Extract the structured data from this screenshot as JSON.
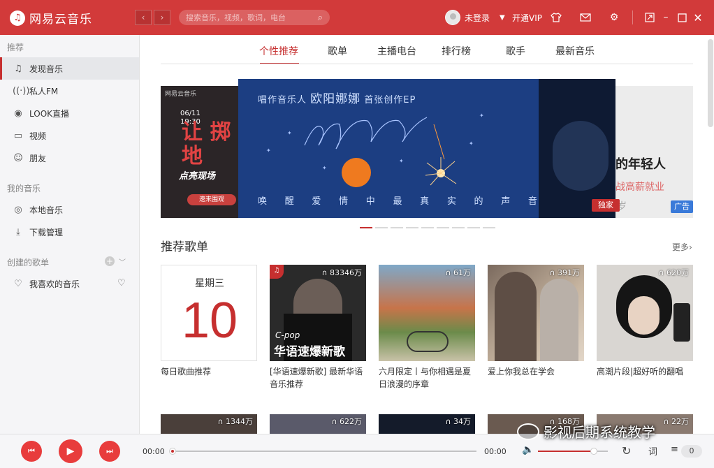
{
  "app": {
    "logo_text": "网易云音乐"
  },
  "titlebar": {
    "back_label": "‹",
    "forward_label": "›",
    "search_placeholder": "搜索音乐，视频，歌词，电台",
    "user_name": "未登录",
    "vip_label": "开通VIP"
  },
  "sidebar": {
    "section_recommend": "推荐",
    "items": [
      {
        "label": "发现音乐",
        "icon": "music-note-icon"
      },
      {
        "label": "私人FM",
        "icon": "radio-icon"
      },
      {
        "label": "LOOK直播",
        "icon": "live-icon"
      },
      {
        "label": "视频",
        "icon": "video-icon"
      },
      {
        "label": "朋友",
        "icon": "friends-icon"
      }
    ],
    "section_my_music": "我的音乐",
    "my_items": [
      {
        "label": "本地音乐",
        "icon": "local-music-icon"
      },
      {
        "label": "下载管理",
        "icon": "download-icon"
      }
    ],
    "section_created": "创建的歌单",
    "created_items": [
      {
        "label": "我喜欢的音乐",
        "icon": "heart-icon"
      }
    ]
  },
  "tabs": [
    "个性推荐",
    "歌单",
    "主播电台",
    "排行榜",
    "歌手",
    "最新音乐"
  ],
  "banner": {
    "left": {
      "mini": "网易云音乐",
      "date": "06/11 19:30",
      "big": "让 掷地",
      "sub": "点亮现场",
      "button": "速来围观"
    },
    "main": {
      "title_prefix": "唱作音乐人",
      "artist": "欧阳娜娜",
      "title_suffix": "首张创作EP",
      "subtitle": [
        "唤",
        "醒",
        "爱",
        "情",
        "中",
        "最",
        "真",
        "实",
        "的",
        "声",
        "音"
      ],
      "exclusive_tag": "独家"
    },
    "right": {
      "text1": "的年轻人",
      "text2": "战高薪就业",
      "text3": "岁",
      "ad_tag": "广告"
    }
  },
  "section": {
    "title": "推荐歌单",
    "more": "更多"
  },
  "daily": {
    "weekday": "星期三",
    "day": "10",
    "caption": "每日歌曲推荐"
  },
  "playlists": [
    {
      "count": "83346万",
      "caption": "[华语速爆新歌] 最新华语音乐推荐",
      "cover_genre": "C-pop",
      "cover_title": "华语速爆新歌"
    },
    {
      "count": "61万",
      "caption": "六月限定丨与你相遇是夏日浪漫的序章"
    },
    {
      "count": "391万",
      "caption": "爱上你我总在学会"
    },
    {
      "count": "620万",
      "caption": "高潮片段|超好听的翻唱"
    }
  ],
  "row2_counts": [
    "1344万",
    "622万",
    "34万",
    "168万",
    "22万"
  ],
  "player": {
    "time_current": "00:00",
    "time_total": "00:00",
    "lyric_label": "词",
    "playlist_count": "0",
    "volume": 0.8
  },
  "watermark": {
    "text": "影视后期系统教学"
  },
  "colors": {
    "brand": "#d23a3a",
    "accent": "#c62f2f"
  }
}
